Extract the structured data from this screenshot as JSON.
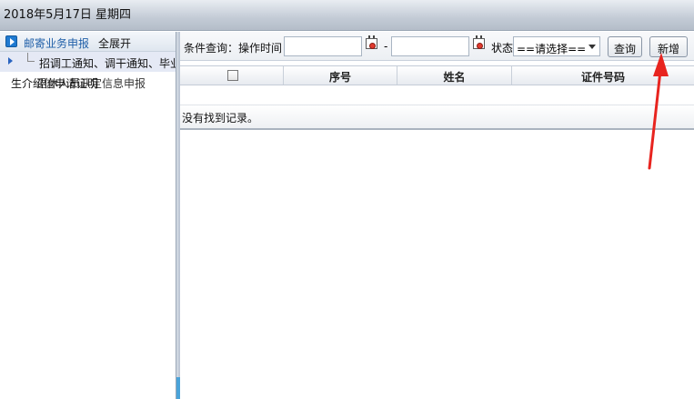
{
  "header": {
    "date": "2018年5月17日 星期四"
  },
  "sidebar": {
    "title": "邮寄业务申报",
    "expand_all": "全展开",
    "tree_item": "招调工通知、调干通知、毕业",
    "item_back": "生介绍信申请证明",
    "item_front": "退休人员认定信息申报"
  },
  "toolbar": {
    "query_label": "条件查询：操作时间",
    "date_from_value": "",
    "date_to_value": "",
    "range_sep": "-",
    "status_label": "状态",
    "status_selected": "==请选择==",
    "query_button": "查询",
    "add_button": "新增"
  },
  "grid": {
    "columns": [
      "序号",
      "姓名",
      "证件号码"
    ],
    "empty_message": "没有找到记录。"
  },
  "colors": {
    "annotation": "#e8241f",
    "accent": "#1f7ad1"
  },
  "icons": [
    "play-icon",
    "calendar-icon",
    "calendar-icon",
    "chevron-down-icon",
    "checkbox-icon"
  ]
}
